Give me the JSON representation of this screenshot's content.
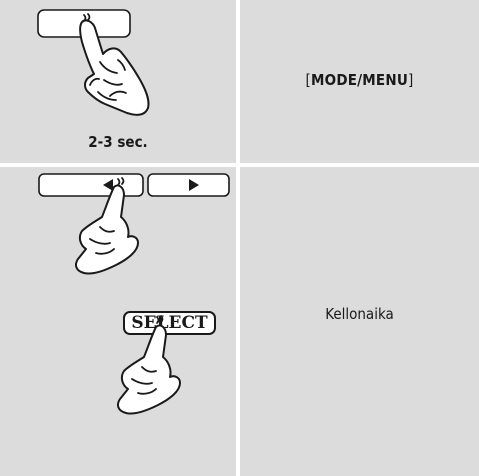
{
  "step1": {
    "instruction": "[MODE/MENU]",
    "instruction_parts": {
      "open": "[",
      "bold": "MODE/MENU",
      "close": "]"
    },
    "duration": "2-3 sec."
  },
  "step2": {
    "select_button": "SELECT",
    "instruction": "Kellonaika"
  }
}
